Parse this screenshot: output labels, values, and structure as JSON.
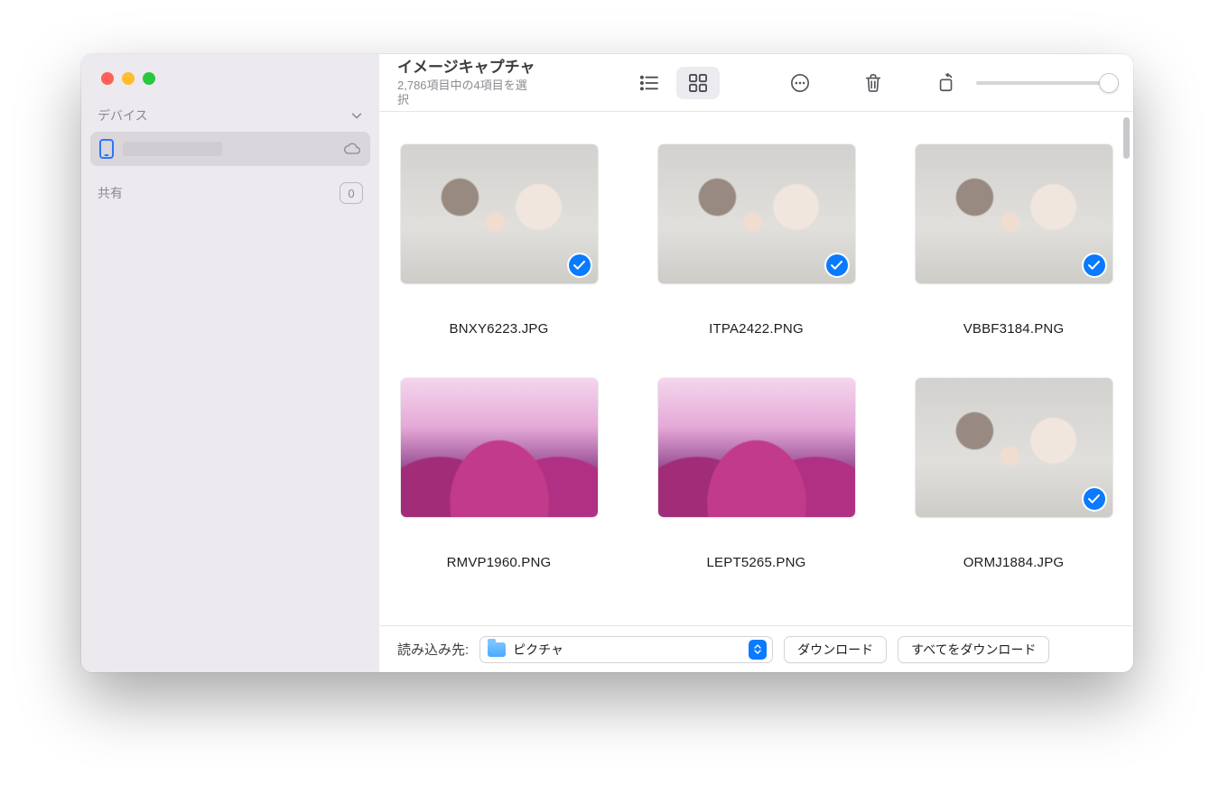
{
  "sidebar": {
    "devices_label": "デバイス",
    "share_label": "共有",
    "share_count": "0"
  },
  "header": {
    "title": "イメージキャプチャ",
    "subtitle": "2,786項目中の4項目を選択"
  },
  "items": [
    {
      "name": "BNXY6223.JPG",
      "art": "people",
      "selected": true
    },
    {
      "name": "ITPA2422.PNG",
      "art": "people",
      "selected": true
    },
    {
      "name": "VBBF3184.PNG",
      "art": "people",
      "selected": true
    },
    {
      "name": "RMVP1960.PNG",
      "art": "flowers",
      "selected": false
    },
    {
      "name": "LEPT5265.PNG",
      "art": "flowers",
      "selected": false
    },
    {
      "name": "ORMJ1884.JPG",
      "art": "people",
      "selected": true
    }
  ],
  "bottom": {
    "dest_label": "読み込み先:",
    "dest_value": "ピクチャ",
    "download": "ダウンロード",
    "download_all": "すべてをダウンロード"
  }
}
